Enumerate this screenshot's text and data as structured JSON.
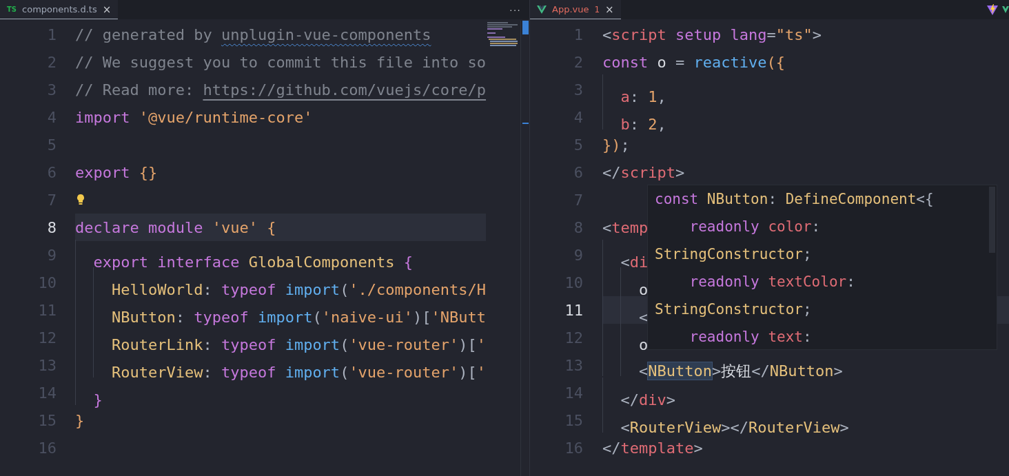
{
  "left_pane": {
    "tab": {
      "icon_text": "TS",
      "label": "components.d.ts",
      "close": "×",
      "selected": true
    },
    "more_actions": "···",
    "lines": [
      {
        "n": "1",
        "current": false,
        "tokens": [
          {
            "kind": "comment",
            "text": "// generated by "
          },
          {
            "kind": "squiggle",
            "text": "unplugin-vue-components"
          }
        ]
      },
      {
        "n": "2",
        "current": false,
        "tokens": [
          {
            "kind": "comment",
            "text": "// We suggest you to commit this file into so"
          }
        ]
      },
      {
        "n": "3",
        "current": false,
        "tokens": [
          {
            "kind": "comment",
            "text": "// Read more: "
          },
          {
            "kind": "link",
            "text": "https://github.com/vuejs/core/p"
          }
        ]
      },
      {
        "n": "4",
        "current": false,
        "tokens": [
          {
            "kind": "keyword",
            "text": "import "
          },
          {
            "kind": "string",
            "text": "'@vue/runtime-core'"
          }
        ]
      },
      {
        "n": "5",
        "current": false
      },
      {
        "n": "6",
        "current": false,
        "tokens": [
          {
            "kind": "keyword",
            "text": "export "
          },
          {
            "kind": "brace",
            "text": "{}"
          }
        ]
      },
      {
        "n": "7",
        "current": false,
        "tokens": [
          {
            "kind": "lightbulb"
          }
        ]
      },
      {
        "n": "8",
        "current": true,
        "tokens": [
          {
            "kind": "keyword",
            "text": "declare module "
          },
          {
            "kind": "string",
            "text": "'vue' "
          },
          {
            "kind": "brace",
            "text": "{"
          }
        ]
      },
      {
        "n": "9",
        "current": false,
        "tokens": [
          {
            "kind": "keyword",
            "text": "  export interface "
          },
          {
            "kind": "type",
            "text": "GlobalComponents "
          },
          {
            "kind": "brace2",
            "text": "{"
          }
        ]
      },
      {
        "n": "10",
        "current": false,
        "tokens": [
          {
            "kind": "type",
            "text": "    HelloWorld"
          },
          {
            "kind": "plain",
            "text": ": "
          },
          {
            "kind": "keyword",
            "text": "typeof "
          },
          {
            "kind": "func",
            "text": "import"
          },
          {
            "kind": "plain",
            "text": "("
          },
          {
            "kind": "string",
            "text": "'./components/H"
          }
        ]
      },
      {
        "n": "11",
        "current": false,
        "tokens": [
          {
            "kind": "type",
            "text": "    NButton"
          },
          {
            "kind": "plain",
            "text": ": "
          },
          {
            "kind": "keyword",
            "text": "typeof "
          },
          {
            "kind": "func",
            "text": "import"
          },
          {
            "kind": "plain",
            "text": "("
          },
          {
            "kind": "string",
            "text": "'naive-ui'"
          },
          {
            "kind": "plain",
            "text": ")["
          },
          {
            "kind": "string",
            "text": "'NButt"
          }
        ]
      },
      {
        "n": "12",
        "current": false,
        "tokens": [
          {
            "kind": "type",
            "text": "    RouterLink"
          },
          {
            "kind": "plain",
            "text": ": "
          },
          {
            "kind": "keyword",
            "text": "typeof "
          },
          {
            "kind": "func",
            "text": "import"
          },
          {
            "kind": "plain",
            "text": "("
          },
          {
            "kind": "string",
            "text": "'vue-router'"
          },
          {
            "kind": "plain",
            "text": ")["
          },
          {
            "kind": "string",
            "text": "'"
          }
        ]
      },
      {
        "n": "13",
        "current": false,
        "tokens": [
          {
            "kind": "type",
            "text": "    RouterView"
          },
          {
            "kind": "plain",
            "text": ": "
          },
          {
            "kind": "keyword",
            "text": "typeof "
          },
          {
            "kind": "func",
            "text": "import"
          },
          {
            "kind": "plain",
            "text": "("
          },
          {
            "kind": "string",
            "text": "'vue-router'"
          },
          {
            "kind": "plain",
            "text": ")["
          },
          {
            "kind": "string",
            "text": "'"
          }
        ]
      },
      {
        "n": "14",
        "current": false,
        "tokens": [
          {
            "kind": "brace2",
            "text": "  }"
          }
        ]
      },
      {
        "n": "15",
        "current": false,
        "tokens": [
          {
            "kind": "brace",
            "text": "}"
          }
        ]
      },
      {
        "n": "16",
        "current": false
      }
    ]
  },
  "right_pane": {
    "tab": {
      "label": "App.vue",
      "problems": "1",
      "close": "×",
      "selected": true
    },
    "lines": [
      {
        "n": "1",
        "current": false,
        "tokens": [
          {
            "kind": "bracket",
            "text": "<"
          },
          {
            "kind": "tag",
            "text": "script "
          },
          {
            "kind": "attr",
            "text": "setup lang"
          },
          {
            "kind": "plain",
            "text": "="
          },
          {
            "kind": "string",
            "text": "\"ts\""
          },
          {
            "kind": "bracket",
            "text": ">"
          }
        ]
      },
      {
        "n": "2",
        "current": false,
        "tokens": [
          {
            "kind": "keyword",
            "text": "const "
          },
          {
            "kind": "var",
            "text": "o "
          },
          {
            "kind": "plain",
            "text": "= "
          },
          {
            "kind": "func",
            "text": "reactive"
          },
          {
            "kind": "brace",
            "text": "({"
          }
        ]
      },
      {
        "n": "3",
        "current": false,
        "tokens": [
          {
            "kind": "prop",
            "text": "  a"
          },
          {
            "kind": "plain",
            "text": ": "
          },
          {
            "kind": "number",
            "text": "1"
          },
          {
            "kind": "plain",
            "text": ","
          }
        ]
      },
      {
        "n": "4",
        "current": false,
        "tokens": [
          {
            "kind": "prop",
            "text": "  b"
          },
          {
            "kind": "plain",
            "text": ": "
          },
          {
            "kind": "number",
            "text": "2"
          },
          {
            "kind": "plain",
            "text": ","
          }
        ]
      },
      {
        "n": "5",
        "current": false,
        "tokens": [
          {
            "kind": "brace",
            "text": "})"
          },
          {
            "kind": "plain",
            "text": ";"
          }
        ]
      },
      {
        "n": "6",
        "current": false,
        "tokens": [
          {
            "kind": "bracket",
            "text": "</"
          },
          {
            "kind": "tag",
            "text": "script"
          },
          {
            "kind": "bracket",
            "text": ">"
          }
        ]
      },
      {
        "n": "7",
        "current": false
      },
      {
        "n": "8",
        "current": false,
        "tokens": [
          {
            "kind": "bracket",
            "text": "<"
          },
          {
            "kind": "tag",
            "text": "temp"
          }
        ]
      },
      {
        "n": "9",
        "current": false,
        "tokens": [
          {
            "kind": "bracket",
            "text": "  <"
          },
          {
            "kind": "tag",
            "text": "di"
          }
        ]
      },
      {
        "n": "10",
        "current": false,
        "tokens": [
          {
            "kind": "var",
            "text": "    o"
          }
        ]
      },
      {
        "n": "11",
        "current": true,
        "tokens": [
          {
            "kind": "bracket",
            "text": "    <"
          }
        ]
      },
      {
        "n": "12",
        "current": false,
        "tokens": [
          {
            "kind": "var",
            "text": "    o"
          }
        ]
      },
      {
        "n": "13",
        "current": false,
        "tokens": [
          {
            "kind": "bracket",
            "text": "    <"
          },
          {
            "kind": "type-hl",
            "text": "NButton"
          },
          {
            "kind": "bracket",
            "text": ">"
          },
          {
            "kind": "var",
            "text": "按钮"
          },
          {
            "kind": "bracket",
            "text": "</"
          },
          {
            "kind": "type",
            "text": "NButton"
          },
          {
            "kind": "bracket",
            "text": ">"
          }
        ]
      },
      {
        "n": "14",
        "current": false,
        "tokens": [
          {
            "kind": "bracket",
            "text": "  </"
          },
          {
            "kind": "tag",
            "text": "div"
          },
          {
            "kind": "bracket",
            "text": ">"
          }
        ]
      },
      {
        "n": "15",
        "current": false,
        "tokens": [
          {
            "kind": "bracket",
            "text": "  <"
          },
          {
            "kind": "type",
            "text": "RouterView"
          },
          {
            "kind": "bracket",
            "text": "></"
          },
          {
            "kind": "type",
            "text": "RouterView"
          },
          {
            "kind": "bracket",
            "text": ">"
          }
        ]
      },
      {
        "n": "16",
        "current": false,
        "tokens": [
          {
            "kind": "bracket",
            "text": "</"
          },
          {
            "kind": "tag",
            "text": "template"
          },
          {
            "kind": "bracket",
            "text": ">"
          }
        ]
      }
    ],
    "hover_tooltip": {
      "lines": [
        [
          {
            "kind": "keyword",
            "text": "const "
          },
          {
            "kind": "type",
            "text": "NButton"
          },
          {
            "kind": "plain",
            "text": ": "
          },
          {
            "kind": "type",
            "text": "DefineComponent"
          },
          {
            "kind": "plain",
            "text": "<{"
          }
        ],
        [
          {
            "kind": "keyword",
            "text": "    readonly "
          },
          {
            "kind": "prop",
            "text": "color"
          },
          {
            "kind": "plain",
            "text": ":"
          }
        ],
        [
          {
            "kind": "type",
            "text": "StringConstructor"
          },
          {
            "kind": "plain",
            "text": ";"
          }
        ],
        [
          {
            "kind": "keyword",
            "text": "    readonly "
          },
          {
            "kind": "prop",
            "text": "textColor"
          },
          {
            "kind": "plain",
            "text": ":"
          }
        ],
        [
          {
            "kind": "type",
            "text": "StringConstructor"
          },
          {
            "kind": "plain",
            "text": ";"
          }
        ],
        [
          {
            "kind": "keyword",
            "text": "    readonly "
          },
          {
            "kind": "prop",
            "text": "text"
          },
          {
            "kind": "plain",
            "text": ":"
          }
        ]
      ]
    }
  }
}
